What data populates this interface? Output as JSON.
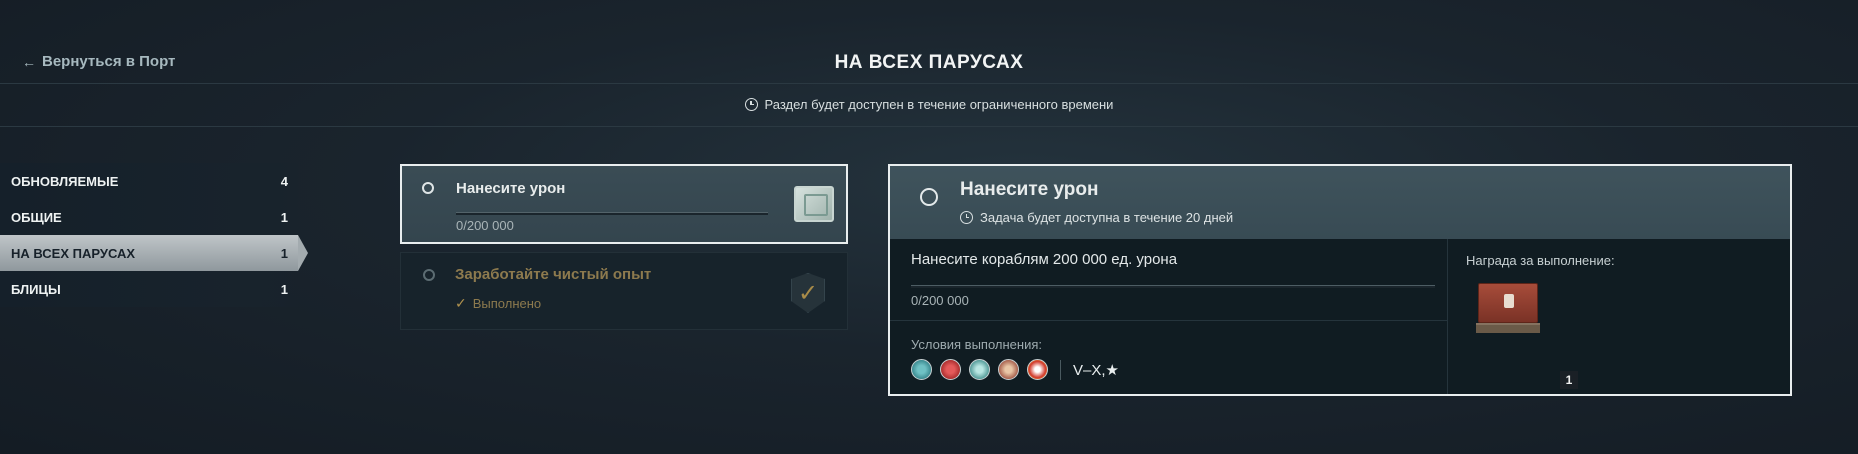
{
  "header": {
    "back_label": "Вернуться в Порт",
    "title": "НА ВСЕХ ПАРУСАХ",
    "timer_note": "Раздел будет доступен в течение ограниченного времени"
  },
  "sidebar": {
    "items": [
      {
        "label": "ОБНОВЛЯЕМЫЕ",
        "count": "4",
        "active": false
      },
      {
        "label": "ОБЩИЕ",
        "count": "1",
        "active": false
      },
      {
        "label": "НА ВСЕХ ПАРУСАХ",
        "count": "1",
        "active": true
      },
      {
        "label": "БЛИЦЫ",
        "count": "1",
        "active": false
      }
    ]
  },
  "tasks": [
    {
      "title": "Нанесите урон",
      "progress": "0/200 000",
      "selected": true
    },
    {
      "title": "Заработайте чистый опыт",
      "status": "Выполнено",
      "completed": true
    }
  ],
  "detail": {
    "title": "Нанесите урон",
    "subtitle": "Задача будет доступна в течение 20 дней",
    "description": "Нанесите кораблям 200 000 ед. урона",
    "progress": "0/200 000",
    "conditions_label": "Условия выполнения:",
    "tiers": "V–X,★",
    "reward_label": "Награда за выполнение:",
    "reward_count": "1"
  },
  "colors": {
    "accent_gold": "#8d7a4e",
    "active_tab": "#a3abaf",
    "selected_border": "#e9eeef"
  }
}
